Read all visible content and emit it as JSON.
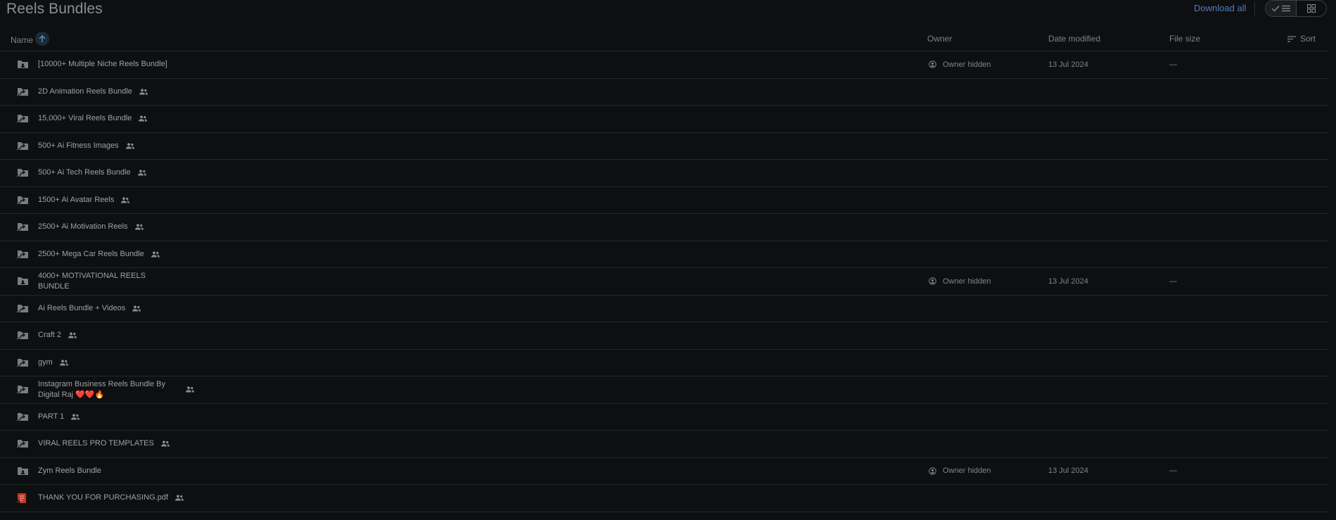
{
  "page": {
    "title": "Reels Bundles"
  },
  "toolbar": {
    "download_all": "Download all"
  },
  "header": {
    "name": "Name",
    "owner": "Owner",
    "date_modified": "Date modified",
    "file_size": "File size",
    "sort": "Sort"
  },
  "colors": {
    "accent": "#4f7fb8",
    "pdf_red": "#c53929",
    "heart": "#e53935",
    "fire": "#ff9800"
  },
  "rows": [
    {
      "name": "[10000+ Multiple Niche Reels Bundle]",
      "icon": "folder-icon",
      "shared": false,
      "owner": "Owner hidden",
      "date": "13 Jul 2024",
      "size": "—"
    },
    {
      "name": "2D Animation Reels Bundle",
      "icon": "folder-shortcut-icon",
      "shared": true
    },
    {
      "name": "15,000+ Viral Reels Bundle",
      "icon": "folder-shortcut-icon",
      "shared": true
    },
    {
      "name": "500+ Ai Fitness Images",
      "icon": "folder-shortcut-icon",
      "shared": true
    },
    {
      "name": "500+ Ai Tech Reels Bundle",
      "icon": "folder-shortcut-icon",
      "shared": true
    },
    {
      "name": "1500+ Ai Avatar Reels",
      "icon": "folder-shortcut-icon",
      "shared": true
    },
    {
      "name": "2500+ Ai Motivation Reels",
      "icon": "folder-shortcut-icon",
      "shared": true
    },
    {
      "name": "2500+ Mega Car Reels Bundle",
      "icon": "folder-shortcut-icon",
      "shared": true
    },
    {
      "name": "4000+ MOTIVATIONAL REELS BUNDLE",
      "icon": "folder-icon",
      "shared": false,
      "owner": "Owner hidden",
      "date": "13 Jul 2024",
      "size": "—"
    },
    {
      "name": "Ai Reels Bundle  + Videos",
      "icon": "folder-shortcut-icon",
      "shared": true
    },
    {
      "name": "Craft 2",
      "icon": "folder-shortcut-icon",
      "shared": true
    },
    {
      "name": "gym",
      "icon": "folder-shortcut-icon",
      "shared": true
    },
    {
      "name": "Instagram Business Reels Bundle By Digital Raj ❤️❤️🔥",
      "icon": "folder-shortcut-icon",
      "shared": true
    },
    {
      "name": "PART 1",
      "icon": "folder-shortcut-icon",
      "shared": true
    },
    {
      "name": "VIRAL REELS PRO TEMPLATES",
      "icon": "folder-shortcut-icon",
      "shared": true
    },
    {
      "name": "Zym Reels Bundle",
      "icon": "folder-icon",
      "shared": false,
      "owner": "Owner hidden",
      "date": "13 Jul 2024",
      "size": "—"
    },
    {
      "name": "THANK YOU FOR PURCHASING.pdf",
      "icon": "pdf-shortcut-icon",
      "shared": true
    }
  ]
}
